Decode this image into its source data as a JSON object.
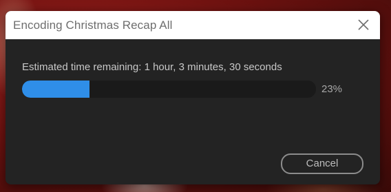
{
  "dialog": {
    "title": "Encoding Christmas Recap All",
    "close_icon": "close-icon",
    "eta_text": "Estimated time remaining: 1 hour, 3 minutes, 30 seconds",
    "progress": {
      "fraction": 0.23,
      "label": "23%",
      "fill_color": "#2f8ee8"
    },
    "cancel_label": "Cancel"
  }
}
